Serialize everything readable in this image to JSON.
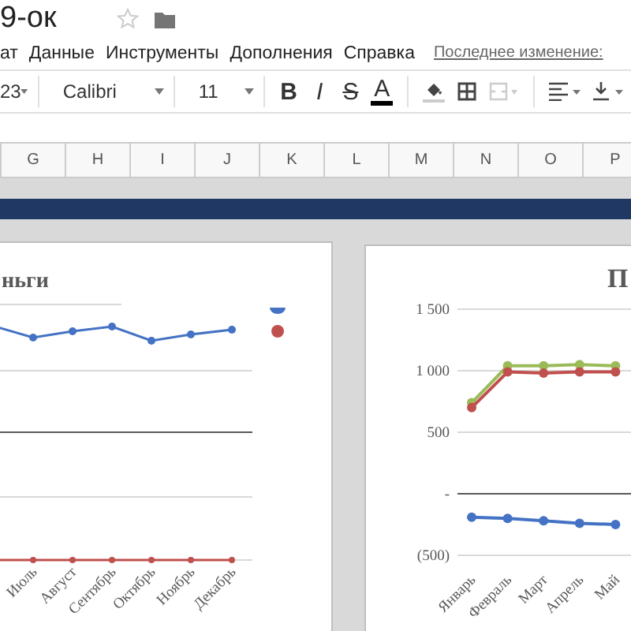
{
  "doc_title": "9-ок",
  "menu": [
    "ат",
    "Данные",
    "Инструменты",
    "Дополнения",
    "Справка"
  ],
  "last_edit": "Последнее изменение:",
  "toolbar": {
    "number_format": "23",
    "font": "Calibri",
    "font_size": "11",
    "text_buttons": [
      {
        "kind": "bold",
        "label": "B"
      },
      {
        "kind": "italic",
        "label": "I"
      },
      {
        "kind": "strike",
        "label": "S"
      },
      {
        "kind": "color",
        "label": "A"
      }
    ],
    "icon_buttons": [
      {
        "kind": "fill",
        "disabled": false
      },
      {
        "kind": "borders",
        "disabled": false
      },
      {
        "kind": "merge",
        "disabled": true
      },
      {
        "kind": "align",
        "disabled": false
      },
      {
        "kind": "valign",
        "disabled": false
      }
    ]
  },
  "columns": [
    "G",
    "H",
    "I",
    "J",
    "K",
    "L",
    "M",
    "N",
    "O",
    "P"
  ],
  "charts": [
    {
      "title": "ньги",
      "x_labels": [
        "Июль",
        "Август",
        "Сентябрь",
        "Октябрь",
        "Ноябрь",
        "Декабрь"
      ],
      "legend": [
        {
          "color": "#4472c4"
        },
        {
          "color": "#c0504d"
        }
      ]
    },
    {
      "title": "П",
      "chart_data": {
        "type": "line",
        "categories": [
          "Январь",
          "Февраль",
          "Март",
          "Апрель",
          "Май"
        ],
        "ylim": [
          -500,
          1500
        ],
        "yticks": [
          {
            "value": 1500,
            "label": "1 500"
          },
          {
            "value": 1000,
            "label": "1 000"
          },
          500,
          {
            "value": 0,
            "label": "-"
          },
          {
            "value": -500,
            "label": "(500)"
          }
        ],
        "series": [
          {
            "color": "#9bbb59",
            "marker": true,
            "values": [
              740,
              1040,
              1040,
              1050,
              1040
            ]
          },
          {
            "color": "#c0504d",
            "marker": true,
            "values": [
              700,
              990,
              980,
              990,
              990
            ]
          },
          {
            "color": "#4472c4",
            "marker": true,
            "values": [
              -190,
              -200,
              -220,
              -240,
              -250
            ]
          }
        ]
      }
    }
  ]
}
